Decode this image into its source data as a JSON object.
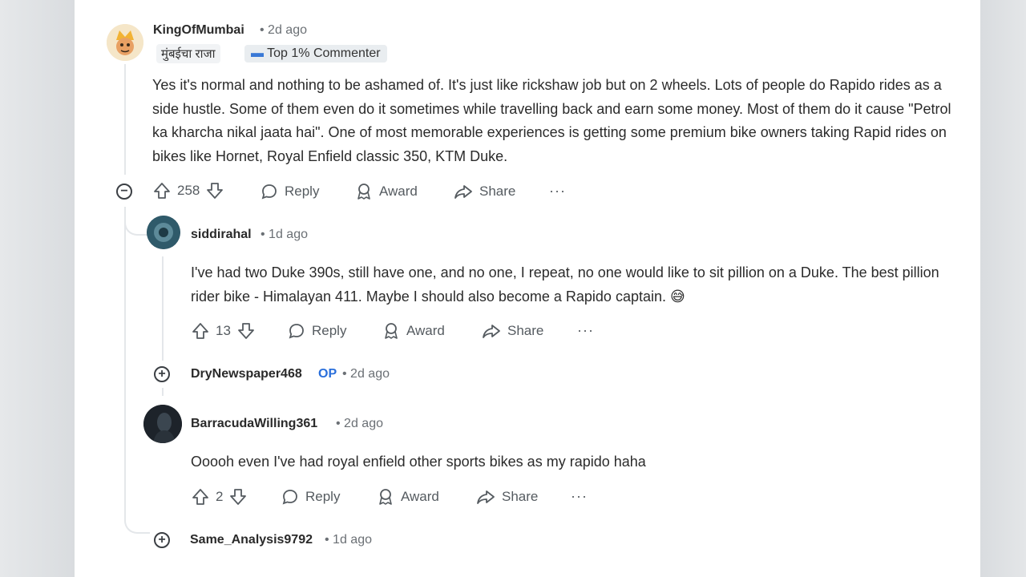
{
  "comments": [
    {
      "username": "KingOfMumbai",
      "meta": "• 2d ago",
      "flair": "मुंबईचा राजा",
      "badge": "Top 1% Commenter",
      "body": "Yes it's normal and nothing to be ashamed of. It's just like rickshaw job but on 2 wheels. Lots of people do Rapido rides as a side hustle. Some of them even do it sometimes while travelling back and earn some money. Most of them do it cause \"Petrol ka kharcha nikal jaata hai\". One of most memorable experiences is getting some premium bike owners taking Rapid rides on bikes like Hornet, Royal Enfield classic 350, KTM Duke.",
      "votes": "258"
    },
    {
      "username": "siddirahal",
      "meta": "• 1d ago",
      "body": "I've had two Duke 390s, still have one, and no one, I repeat, no one would like to sit pillion on a Duke. The best pillion rider bike - Himalayan 411. Maybe I should also become a Rapido captain. 😅",
      "votes": "13"
    },
    {
      "username": "DryNewspaper468",
      "op": "OP",
      "meta": "• 2d ago"
    },
    {
      "username": "BarracudaWilling361",
      "meta": "• 2d ago",
      "body": "Ooooh even I've had royal enfield other sports bikes as my rapido haha",
      "votes": "2"
    },
    {
      "username": "Same_Analysis9792",
      "meta": "• 1d ago"
    }
  ],
  "actions": {
    "reply": "Reply",
    "award": "Award",
    "share": "Share",
    "more": "···"
  },
  "controls": {
    "collapse": "−",
    "expand": "+"
  },
  "icons": [
    "upvote-icon",
    "downvote-icon",
    "reply-icon",
    "award-icon",
    "share-icon"
  ]
}
